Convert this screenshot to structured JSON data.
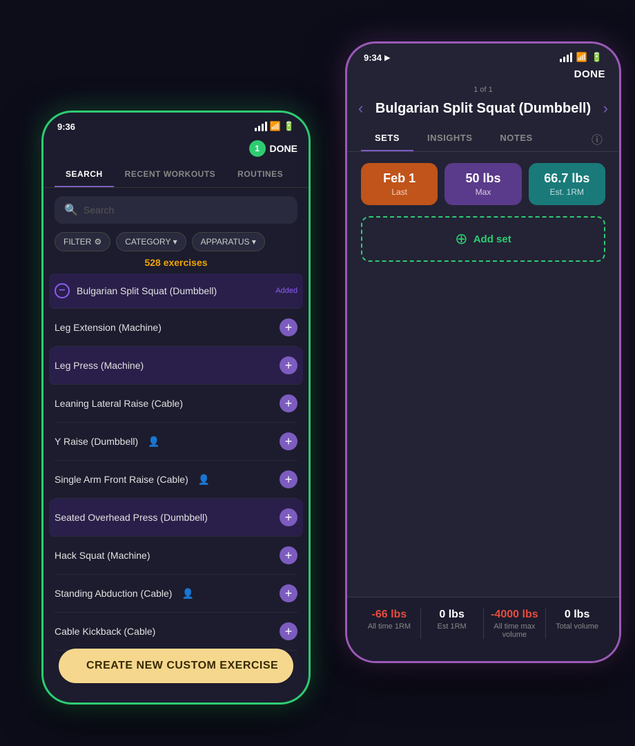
{
  "phone1": {
    "status": {
      "time": "9:36",
      "location_icon": "◂",
      "signal": "▐▐▐",
      "wifi": "wifi",
      "battery": "battery"
    },
    "header": {
      "badge_count": "1",
      "done_label": "DONE"
    },
    "tabs": [
      {
        "id": "search",
        "label": "SEARCH",
        "active": true
      },
      {
        "id": "recent",
        "label": "RECENT WORKOUTS",
        "active": false
      },
      {
        "id": "routines",
        "label": "ROUTINES",
        "active": false
      }
    ],
    "search_placeholder": "Search",
    "filters": [
      {
        "id": "filter",
        "label": "FILTER"
      },
      {
        "id": "category",
        "label": "CATEGORY ▾"
      },
      {
        "id": "apparatus",
        "label": "APPARATUS ▾"
      }
    ],
    "exercise_count": "528",
    "exercise_count_suffix": " exercises",
    "exercises": [
      {
        "name": "Bulgarian Split Squat (Dumbbell)",
        "action": "minus",
        "extra": "Added",
        "highlighted": true
      },
      {
        "name": "Leg Extension (Machine)",
        "action": "plus",
        "extra": ""
      },
      {
        "name": "Leg Press (Machine)",
        "action": "plus",
        "extra": "",
        "highlighted": true
      },
      {
        "name": "Leaning Lateral Raise (Cable)",
        "action": "plus",
        "extra": ""
      },
      {
        "name": "Y Raise (Dumbbell)",
        "action": "plus",
        "extra": "person",
        "highlighted": false
      },
      {
        "name": "Single Arm Front Raise (Cable)",
        "action": "plus",
        "extra": "person"
      },
      {
        "name": "Seated Overhead Press (Dumbbell)",
        "action": "plus",
        "extra": "",
        "highlighted": true
      },
      {
        "name": "Hack Squat (Machine)",
        "action": "plus",
        "extra": ""
      },
      {
        "name": "Standing Abduction (Cable)",
        "action": "plus",
        "extra": "person",
        "highlighted": false
      },
      {
        "name": "Cable Kickback (Cable)",
        "action": "plus",
        "extra": ""
      }
    ],
    "create_button_label": "CREATE NEW CUSTOM EXERCISE"
  },
  "phone2": {
    "status": {
      "time": "9:34",
      "location_icon": "◂"
    },
    "done_label": "DONE",
    "page_indicator": "1 of 1",
    "exercise_title": "Bulgarian Split Squat (Dumbbell)",
    "tabs": [
      {
        "id": "sets",
        "label": "SETS",
        "active": true
      },
      {
        "id": "insights",
        "label": "INSIGHTS",
        "active": false
      },
      {
        "id": "notes",
        "label": "NOTES",
        "active": false
      }
    ],
    "stats": [
      {
        "id": "last",
        "val": "Feb 1",
        "lbl": "Last",
        "color": "orange"
      },
      {
        "id": "max",
        "val": "50 lbs",
        "lbl": "Max",
        "color": "purple"
      },
      {
        "id": "orm",
        "val": "66.7 lbs",
        "lbl": "Est. 1RM",
        "color": "teal"
      }
    ],
    "add_set_label": "Add set",
    "bottom_stats": [
      {
        "id": "all_time_1rm",
        "val": "-66 lbs",
        "lbl": "All time 1RM",
        "color": "red"
      },
      {
        "id": "est_1rm",
        "val": "0 lbs",
        "lbl": "Est 1RM",
        "color": "white"
      },
      {
        "id": "all_time_vol",
        "val": "-4000 lbs",
        "lbl": "All time max volume",
        "color": "red"
      },
      {
        "id": "total_vol",
        "val": "0 lbs",
        "lbl": "Total volume",
        "color": "white"
      }
    ]
  }
}
